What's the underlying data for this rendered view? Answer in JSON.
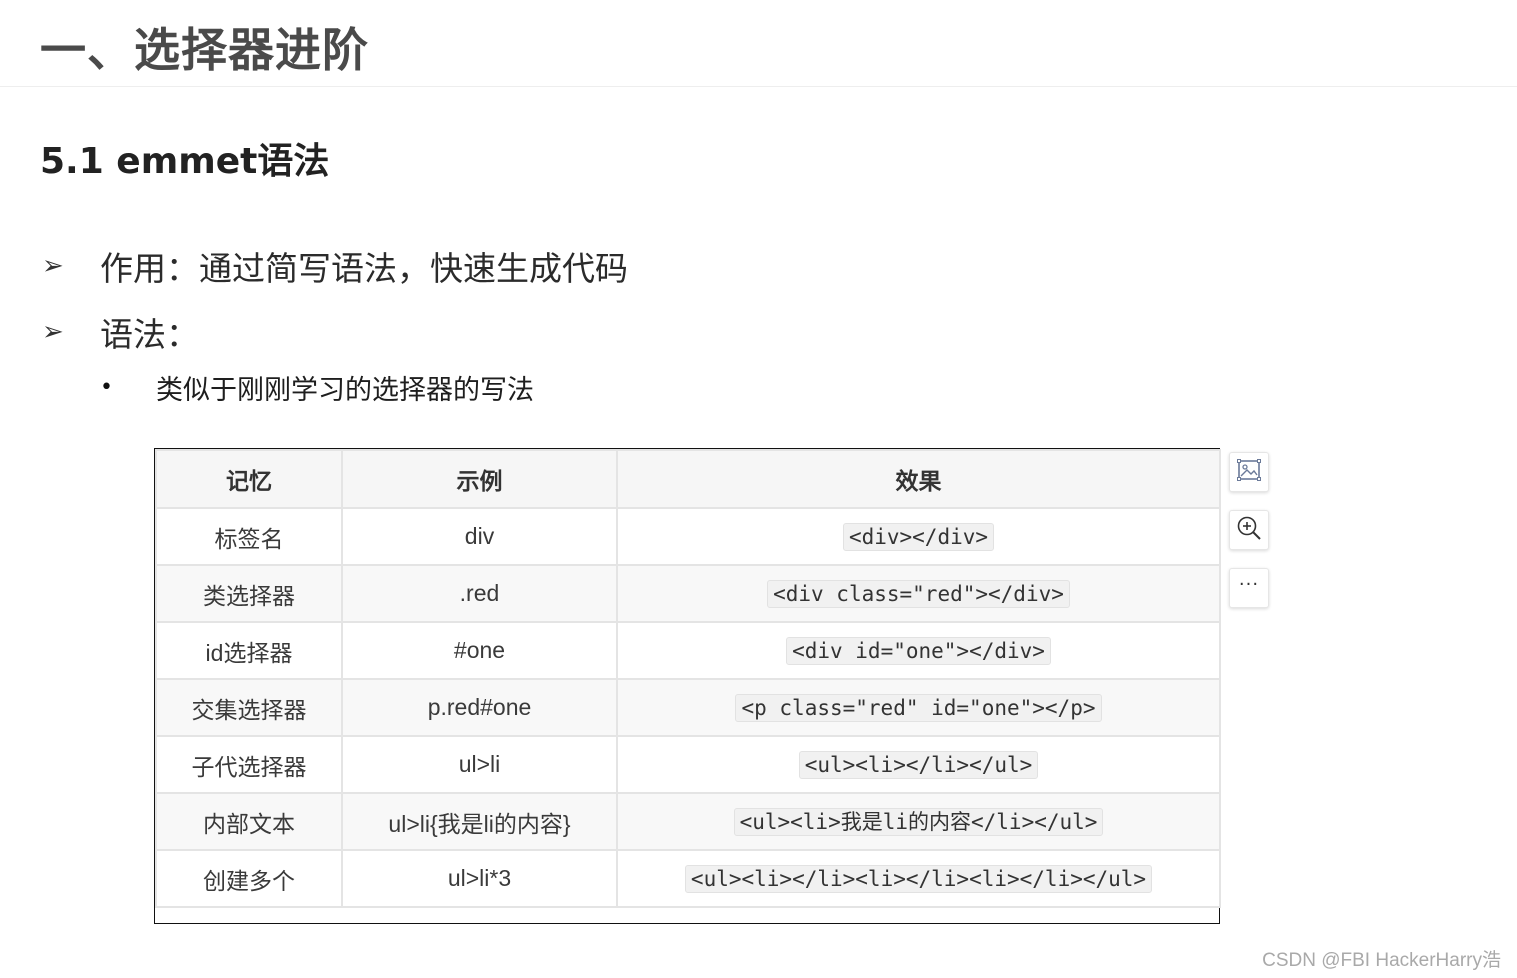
{
  "heading1": "一、选择器进阶",
  "heading2": "5.1 emmet语法",
  "bullets": [
    {
      "marker": "➢",
      "text": "作用：通过简写语法，快速生成代码"
    },
    {
      "marker": "➢",
      "text": "语法："
    }
  ],
  "sub_bullet": {
    "marker": "•",
    "text": "类似于刚刚学习的选择器的写法"
  },
  "table": {
    "headers": [
      "记忆",
      "示例",
      "效果"
    ],
    "rows": [
      [
        "标签名",
        "div",
        "<div></div>"
      ],
      [
        "类选择器",
        ".red",
        "<div class=\"red\"></div>"
      ],
      [
        "id选择器",
        "#one",
        "<div id=\"one\"></div>"
      ],
      [
        "交集选择器",
        "p.red#one",
        "<p class=\"red\" id=\"one\"></p>"
      ],
      [
        "子代选择器",
        "ul>li",
        "<ul><li></li></ul>"
      ],
      [
        "内部文本",
        "ul>li{我是li的内容}",
        "<ul><li>我是li的内容</li></ul>"
      ],
      [
        "创建多个",
        "ul>li*3",
        "<ul><li></li><li></li><li></li></ul>"
      ]
    ]
  },
  "toolbar": {
    "icons": [
      "image-icon",
      "zoom-in-icon",
      "more-icon"
    ],
    "more_label": "···"
  },
  "watermark": "CSDN @FBI HackerHarry浩"
}
